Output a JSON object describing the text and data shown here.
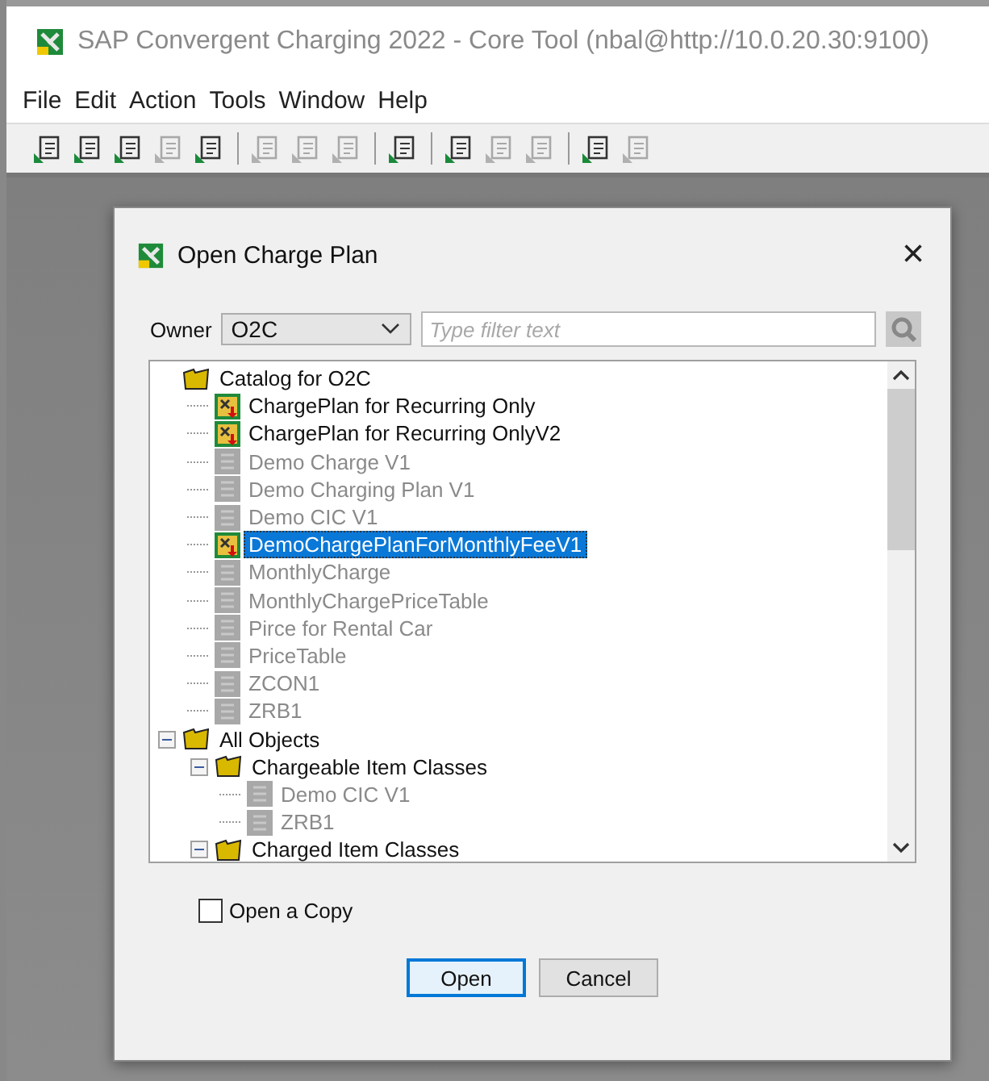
{
  "window": {
    "title": "SAP Convergent Charging 2022 - Core Tool (nbal@http://10.0.20.30:9100)"
  },
  "menu": [
    "File",
    "Edit",
    "Action",
    "Tools",
    "Window",
    "Help"
  ],
  "toolbar": [
    [
      {
        "disabled": false
      },
      {
        "disabled": false
      },
      {
        "disabled": false
      },
      {
        "disabled": true
      },
      {
        "disabled": false
      }
    ],
    [
      {
        "disabled": true
      },
      {
        "disabled": true
      },
      {
        "disabled": true
      }
    ],
    [
      {
        "disabled": false
      }
    ],
    [
      {
        "disabled": false
      },
      {
        "disabled": true
      },
      {
        "disabled": true
      }
    ],
    [
      {
        "disabled": false
      },
      {
        "disabled": true
      }
    ]
  ],
  "dialog": {
    "title": "Open Charge Plan",
    "close": "×",
    "owner": {
      "label": "Owner",
      "value": "O2C"
    },
    "filter": {
      "placeholder": "Type filter text"
    },
    "tree": [
      {
        "label": "Catalog for O2C",
        "kind": "folder",
        "disabled": false,
        "selected": false,
        "children": [
          {
            "label": "ChargePlan for Recurring Only",
            "kind": "plan",
            "disabled": false,
            "selected": false
          },
          {
            "label": "ChargePlan for Recurring OnlyV2",
            "kind": "plan",
            "disabled": false,
            "selected": false
          },
          {
            "label": "Demo Charge V1",
            "kind": "item",
            "disabled": true,
            "selected": false
          },
          {
            "label": "Demo Charging Plan V1",
            "kind": "item",
            "disabled": true,
            "selected": false
          },
          {
            "label": "Demo CIC V1",
            "kind": "item",
            "disabled": true,
            "selected": false
          },
          {
            "label": "DemoChargePlanForMonthlyFeeV1",
            "kind": "plan",
            "disabled": false,
            "selected": true
          },
          {
            "label": "MonthlyCharge",
            "kind": "item",
            "disabled": true,
            "selected": false
          },
          {
            "label": "MonthlyChargePriceTable",
            "kind": "item",
            "disabled": true,
            "selected": false
          },
          {
            "label": "Pirce for Rental Car",
            "kind": "item",
            "disabled": true,
            "selected": false
          },
          {
            "label": "PriceTable",
            "kind": "item",
            "disabled": true,
            "selected": false
          },
          {
            "label": "ZCON1",
            "kind": "item",
            "disabled": true,
            "selected": false
          },
          {
            "label": "ZRB1",
            "kind": "item",
            "disabled": true,
            "selected": false
          }
        ]
      },
      {
        "label": "All Objects",
        "kind": "folder",
        "disabled": false,
        "selected": false,
        "expanded": true,
        "children": [
          {
            "label": "Chargeable Item Classes",
            "kind": "folder",
            "disabled": false,
            "selected": false,
            "expanded": true,
            "children": [
              {
                "label": "Demo CIC V1",
                "kind": "item",
                "disabled": true,
                "selected": false
              },
              {
                "label": "ZRB1",
                "kind": "item",
                "disabled": true,
                "selected": false
              }
            ]
          },
          {
            "label": "Charged Item Classes",
            "kind": "folder",
            "disabled": false,
            "selected": false,
            "expanded": true
          }
        ]
      }
    ],
    "open_copy": {
      "label": "Open a Copy",
      "checked": false
    },
    "buttons": [
      {
        "label": "Open",
        "default": true
      },
      {
        "label": "Cancel",
        "default": false
      }
    ]
  }
}
